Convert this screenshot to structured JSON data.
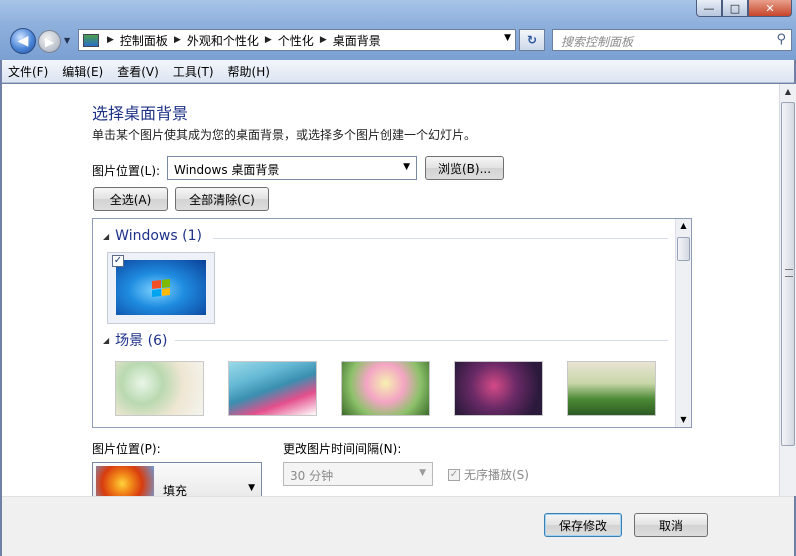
{
  "window": {
    "buttons": {
      "minimize": "—",
      "maximize": "□",
      "close": "✕"
    }
  },
  "nav": {
    "back_icon": "arrow-left-icon",
    "forward_icon": "arrow-right-icon",
    "breadcrumbs": [
      "控制面板",
      "外观和个性化",
      "个性化",
      "桌面背景"
    ],
    "search_placeholder": "搜索控制面板"
  },
  "menu": [
    "文件(F)",
    "编辑(E)",
    "查看(V)",
    "工具(T)",
    "帮助(H)"
  ],
  "main": {
    "title": "选择桌面背景",
    "description": "单击某个图片使其成为您的桌面背景，或选择多个图片创建一个幻灯片。",
    "location_label": "图片位置(L):",
    "location_value": "Windows 桌面背景",
    "browse_label": "浏览(B)...",
    "select_all_label": "全选(A)",
    "clear_all_label": "全部清除(C)",
    "groups": [
      {
        "name": "Windows (1)",
        "checked": true
      },
      {
        "name": "场景 (6)"
      }
    ],
    "position_label": "图片位置(P):",
    "position_value": "填充",
    "interval_label": "更改图片时间间隔(N):",
    "interval_value": "30 分钟",
    "shuffle_label": "无序播放(S)",
    "shuffle_checked": true
  },
  "footer": {
    "save_label": "保存修改",
    "cancel_label": "取消"
  }
}
